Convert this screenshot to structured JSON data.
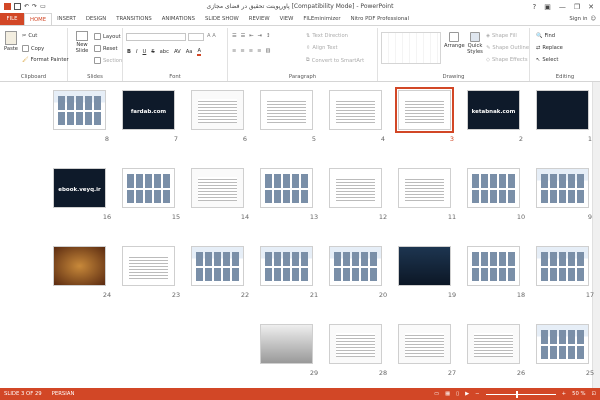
{
  "window": {
    "title": "پاورپوینت تحقیق در فضای مجازی [Compatibility Mode] - PowerPoint",
    "help": "?",
    "minimize": "—",
    "restore": "❐",
    "close": "✕"
  },
  "tabs": {
    "file": "FILE",
    "items": [
      "HOME",
      "INSERT",
      "DESIGN",
      "TRANSITIONS",
      "ANIMATIONS",
      "SLIDE SHOW",
      "REVIEW",
      "VIEW",
      "FILEminimizer",
      "Nitro PDF Professional"
    ],
    "signin": "Sign in"
  },
  "ribbon": {
    "clipboard": {
      "label": "Clipboard",
      "paste": "Paste",
      "cut": "Cut",
      "copy": "Copy",
      "format_painter": "Format Painter"
    },
    "slides": {
      "label": "Slides",
      "new_slide": "New Slide",
      "layout": "Layout",
      "reset": "Reset",
      "section": "Section"
    },
    "font": {
      "label": "Font",
      "bold": "B",
      "italic": "I",
      "underline": "U",
      "strike": "S",
      "shadow": "abc",
      "spacing": "AV",
      "case": "Aa",
      "color": "A"
    },
    "paragraph": {
      "label": "Paragraph",
      "text_direction": "Text Direction",
      "align_text": "Align Text",
      "convert_smartart": "Convert to SmartArt"
    },
    "drawing": {
      "label": "Drawing",
      "arrange": "Arrange",
      "quick_styles": "Quick Styles",
      "shape_fill": "Shape Fill",
      "shape_outline": "Shape Outline",
      "shape_effects": "Shape Effects"
    },
    "editing": {
      "label": "Editing",
      "find": "Find",
      "replace": "Replace",
      "select": "Select"
    }
  },
  "slides": [
    {
      "n": "1",
      "text": "",
      "style": "dark"
    },
    {
      "n": "2",
      "text": "ketabnak.com",
      "style": "dark"
    },
    {
      "n": "3",
      "text": "",
      "style": "list",
      "selected": true
    },
    {
      "n": "4",
      "text": "",
      "style": "list"
    },
    {
      "n": "5",
      "text": "",
      "style": "list"
    },
    {
      "n": "6",
      "text": "",
      "style": "doc"
    },
    {
      "n": "7",
      "text": "fardab.com",
      "style": "dark"
    },
    {
      "n": "8",
      "text": "",
      "style": "web"
    },
    {
      "n": "9",
      "text": "",
      "style": "web"
    },
    {
      "n": "10",
      "text": "",
      "style": "grid"
    },
    {
      "n": "11",
      "text": "",
      "style": "list"
    },
    {
      "n": "12",
      "text": "",
      "style": "list"
    },
    {
      "n": "13",
      "text": "",
      "style": "grid"
    },
    {
      "n": "14",
      "text": "",
      "style": "doc"
    },
    {
      "n": "15",
      "text": "",
      "style": "grid"
    },
    {
      "n": "16",
      "text": "ebook.veyq.ir",
      "style": "dark"
    },
    {
      "n": "17",
      "text": "",
      "style": "web"
    },
    {
      "n": "18",
      "text": "",
      "style": "grid"
    },
    {
      "n": "19",
      "text": "",
      "style": "darkweb"
    },
    {
      "n": "20",
      "text": "",
      "style": "web"
    },
    {
      "n": "21",
      "text": "",
      "style": "web"
    },
    {
      "n": "22",
      "text": "",
      "style": "web"
    },
    {
      "n": "23",
      "text": "",
      "style": "list"
    },
    {
      "n": "24",
      "text": "",
      "style": "theater"
    },
    {
      "n": "25",
      "text": "",
      "style": "web"
    },
    {
      "n": "26",
      "text": "",
      "style": "doc"
    },
    {
      "n": "27",
      "text": "",
      "style": "doc"
    },
    {
      "n": "28",
      "text": "",
      "style": "doc"
    },
    {
      "n": "29",
      "text": "",
      "style": "laptop"
    }
  ],
  "status": {
    "slide": "SLIDE 3 OF 29",
    "language": "PERSIAN",
    "zoom": "50 %",
    "zoom_minus": "−",
    "zoom_plus": "+"
  },
  "colors": {
    "accent": "#d24726"
  }
}
